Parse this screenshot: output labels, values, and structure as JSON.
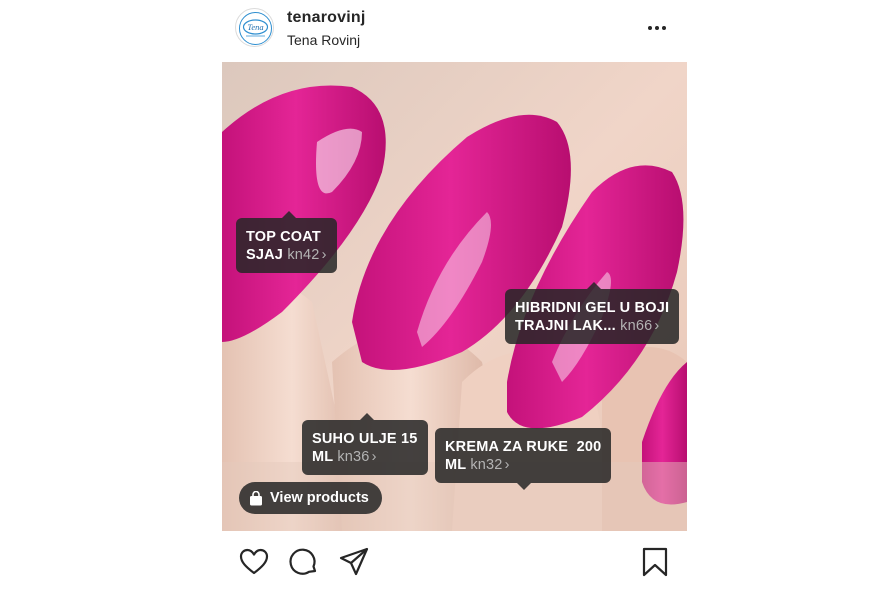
{
  "post": {
    "username": "tenarovinj",
    "location": "Tena Rovinj",
    "avatar_text": "Tena"
  },
  "tags": [
    {
      "line1": "TOP COAT",
      "line2": "SJAJ",
      "price": "kn42"
    },
    {
      "line1": "HIBRIDNI GEL U BOJI",
      "line2": "TRAJNI LAK...",
      "price": "kn66"
    },
    {
      "line1": "SUHO ULJE 15",
      "line2": "ML",
      "price": "kn36"
    },
    {
      "line1": "KREMA ZA RUKE  200",
      "line2": "ML",
      "price": "kn32"
    }
  ],
  "view_products_label": "View products",
  "colors": {
    "nail_pink": "#e0208f",
    "skin": "#efd2c4",
    "tag_bg": "#262626"
  },
  "icons": {
    "more": "ellipsis-icon",
    "like": "heart-icon",
    "comment": "comment-icon",
    "share": "paper-plane-icon",
    "save": "bookmark-icon",
    "bag": "shopping-bag-icon"
  }
}
